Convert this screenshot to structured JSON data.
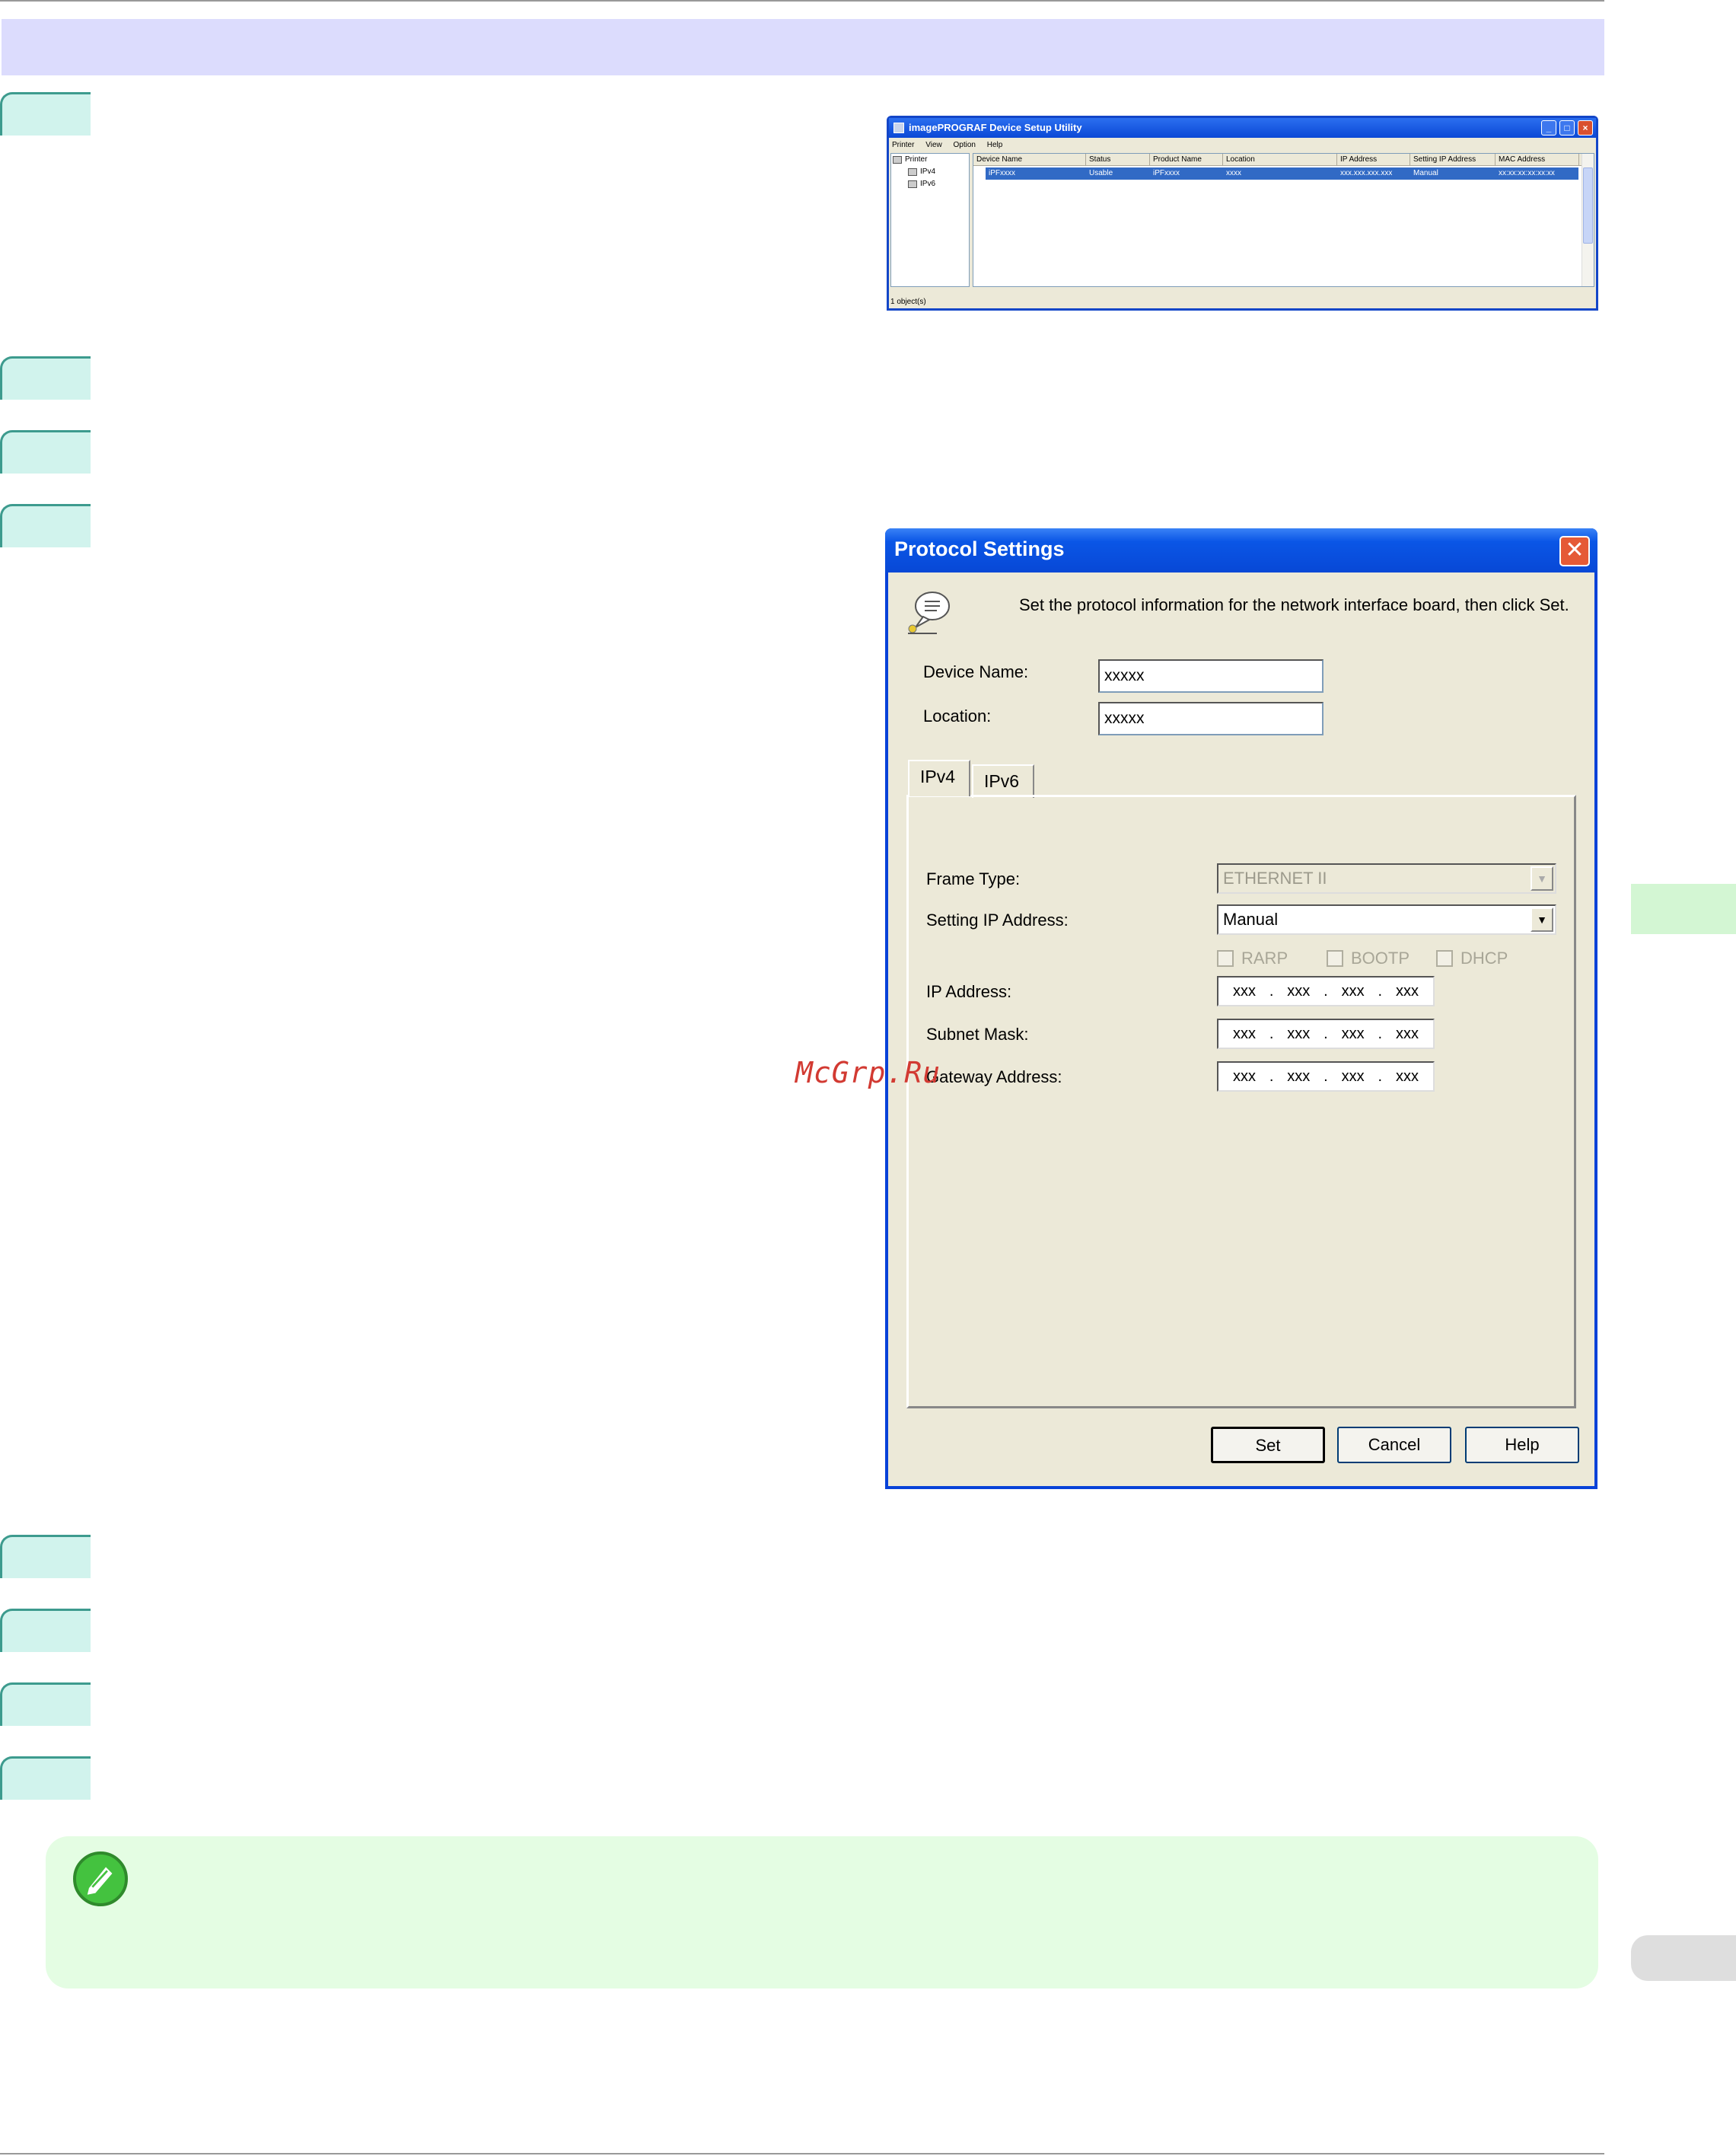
{
  "util_window": {
    "title": "imagePROGRAF Device Setup Utility",
    "menu": [
      "Printer",
      "View",
      "Option",
      "Help"
    ],
    "tree": [
      "Printer",
      "IPv4",
      "IPv6"
    ],
    "columns": [
      "Device Name",
      "Status",
      "Product Name",
      "Location",
      "IP Address",
      "Setting IP Address",
      "MAC Address"
    ],
    "row": [
      "iPFxxxx",
      "Usable",
      "iPFxxxx",
      "xxxx",
      "xxx.xxx.xxx.xxx",
      "Manual",
      "xx:xx:xx:xx:xx:xx"
    ],
    "status": "1 object(s)"
  },
  "dialog": {
    "title": "Protocol Settings",
    "instruction": "Set the protocol information for the network interface board, then click Set.",
    "device_name_label": "Device Name:",
    "device_name_value": "xxxxx",
    "location_label": "Location:",
    "location_value": "xxxxx",
    "tabs": [
      "IPv4",
      "IPv6"
    ],
    "frame_type_label": "Frame Type:",
    "frame_type_value": "ETHERNET II",
    "setting_ip_label": "Setting IP Address:",
    "setting_ip_value": "Manual",
    "checkboxes": [
      "RARP",
      "BOOTP",
      "DHCP"
    ],
    "ip_address_label": "IP Address:",
    "subnet_label": "Subnet Mask:",
    "gateway_label": "Gateway Address:",
    "octet": "xxx",
    "dot": ".",
    "buttons": {
      "set": "Set",
      "cancel": "Cancel",
      "help": "Help"
    }
  },
  "watermark": "McGrp.Ru"
}
